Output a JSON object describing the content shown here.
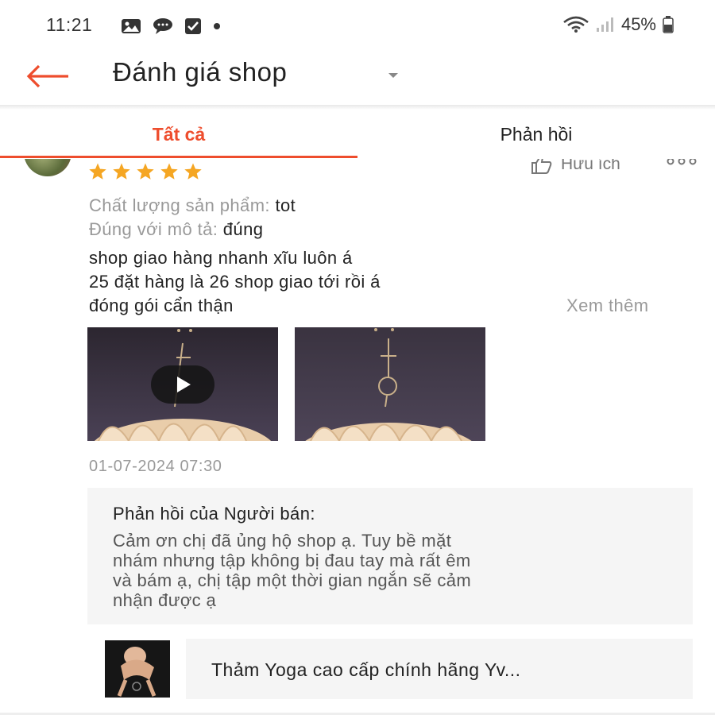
{
  "status_bar": {
    "time": "11:21",
    "battery": "45%",
    "icons": [
      "image-icon",
      "chat-icon",
      "check-box-icon",
      "dot-icon",
      "wifi-icon",
      "signal-icon",
      "battery-icon"
    ]
  },
  "header": {
    "title": "Đánh giá shop",
    "back_icon": "arrow-left-icon",
    "dropdown_icon": "caret-down-icon"
  },
  "tabs": [
    {
      "label": "Tất cả",
      "active": true
    },
    {
      "label": "Phản hồi",
      "active": false
    }
  ],
  "review": {
    "rating": 5,
    "helpful_label": "Hữu ích",
    "attributes": [
      {
        "key": "Chất lượng sản phẩm:",
        "value": "tot"
      },
      {
        "key": "Đúng với mô tả:",
        "value": "đúng"
      }
    ],
    "text_lines": [
      "shop giao hàng nhanh xĩu luôn á",
      "25 đặt hàng là 26 shop giao tới rồi á",
      "đóng gói cẩn thận"
    ],
    "see_more": "Xem thêm",
    "date": "01-07-2024 07:30",
    "seller_reply": {
      "title": "Phản hồi của Người bán:",
      "lines": [
        "Cảm ơn chị đã ủng hộ shop ạ. Tuy bề mặt",
        "nhám nhưng tập không bị đau tay mà rất êm",
        "và bám ạ, chị tập một thời gian ngắn sẽ cảm",
        "nhận được ạ"
      ]
    },
    "product_name": "Thảm Yoga cao cấp chính hãng Yv..."
  },
  "colors": {
    "accent": "#ee4d2d",
    "star": "#f5a623",
    "muted_text": "#999999",
    "panel_bg": "#f5f5f5"
  }
}
